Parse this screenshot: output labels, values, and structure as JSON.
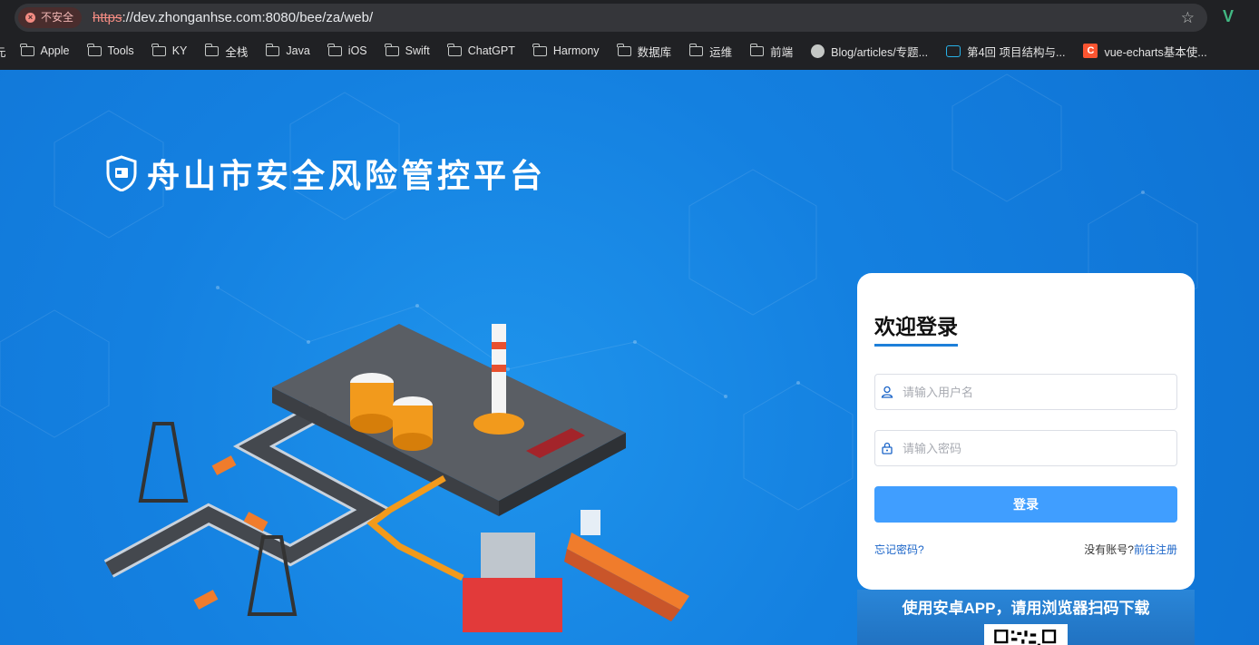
{
  "browser": {
    "security_label": "不安全",
    "url_scheme": "https",
    "url_rest": "://dev.zhonganhse.com:8080/bee/za/web/",
    "icons": [
      "insecure-icon",
      "bookmark-star-icon",
      "vue-devtools-icon"
    ]
  },
  "bookmarks": [
    {
      "label": "元",
      "icon": "none"
    },
    {
      "label": "Apple",
      "icon": "folder-icon"
    },
    {
      "label": "Tools",
      "icon": "folder-icon"
    },
    {
      "label": "KY",
      "icon": "folder-icon"
    },
    {
      "label": "全栈",
      "icon": "folder-icon"
    },
    {
      "label": "Java",
      "icon": "folder-icon"
    },
    {
      "label": "iOS",
      "icon": "folder-icon"
    },
    {
      "label": "Swift",
      "icon": "folder-icon"
    },
    {
      "label": "ChatGPT",
      "icon": "folder-icon"
    },
    {
      "label": "Harmony",
      "icon": "folder-icon"
    },
    {
      "label": "数据库",
      "icon": "folder-icon"
    },
    {
      "label": "运维",
      "icon": "folder-icon"
    },
    {
      "label": "前端",
      "icon": "folder-icon"
    },
    {
      "label": "Blog/articles/专题...",
      "icon": "github-icon"
    },
    {
      "label": "第4回 项目结构与...",
      "icon": "bilibili-icon"
    },
    {
      "label": "vue-echarts基本使...",
      "icon": "csdn-icon"
    }
  ],
  "page": {
    "brand_title": "舟山市安全风险管控平台",
    "login": {
      "heading": "欢迎登录",
      "username_placeholder": "请输入用户名",
      "password_placeholder": "请输入密码",
      "submit_label": "登录",
      "forgot_label": "忘记密码?",
      "no_account_label": "没有账号?",
      "register_label": "前往注册"
    },
    "app_download_text": "使用安卓APP，请用浏览器扫码下载"
  },
  "colors": {
    "page_bg": "#1480e0",
    "primary_button": "#409eff",
    "link": "#1a64c8",
    "heading_underline": "#1d7fd9"
  }
}
